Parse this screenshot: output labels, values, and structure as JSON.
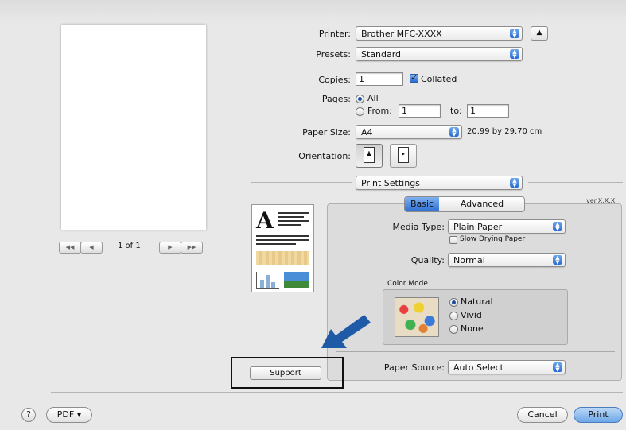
{
  "printer": {
    "label": "Printer:",
    "value": "Brother MFC-XXXX"
  },
  "presets": {
    "label": "Presets:",
    "value": "Standard"
  },
  "copies": {
    "label": "Copies:",
    "value": "1",
    "collated_label": "Collated"
  },
  "pages": {
    "label": "Pages:",
    "all_label": "All",
    "from_label": "From:",
    "from_value": "1",
    "to_label": "to:",
    "to_value": "1"
  },
  "paper_size": {
    "label": "Paper Size:",
    "value": "A4",
    "dimensions": "20.99 by 29.70 cm"
  },
  "orientation": {
    "label": "Orientation:"
  },
  "panel_select": {
    "value": "Print Settings"
  },
  "tabs": {
    "basic": "Basic",
    "advanced": "Advanced",
    "version": "ver.X.X.X"
  },
  "media_type": {
    "label": "Media Type:",
    "value": "Plain Paper",
    "slow_drying_label": "Slow Drying Paper"
  },
  "quality": {
    "label": "Quality:",
    "value": "Normal"
  },
  "color_mode": {
    "title": "Color Mode",
    "natural": "Natural",
    "vivid": "Vivid",
    "none": "None"
  },
  "paper_source": {
    "label": "Paper Source:",
    "value": "Auto Select"
  },
  "support_button": "Support",
  "preview": {
    "page_indicator": "1 of 1"
  },
  "footer": {
    "help": "?",
    "pdf": "PDF ▾",
    "cancel": "Cancel",
    "print": "Print"
  },
  "colors": {
    "accent": "#2a6bd0",
    "arrow": "#1f5aa6"
  }
}
